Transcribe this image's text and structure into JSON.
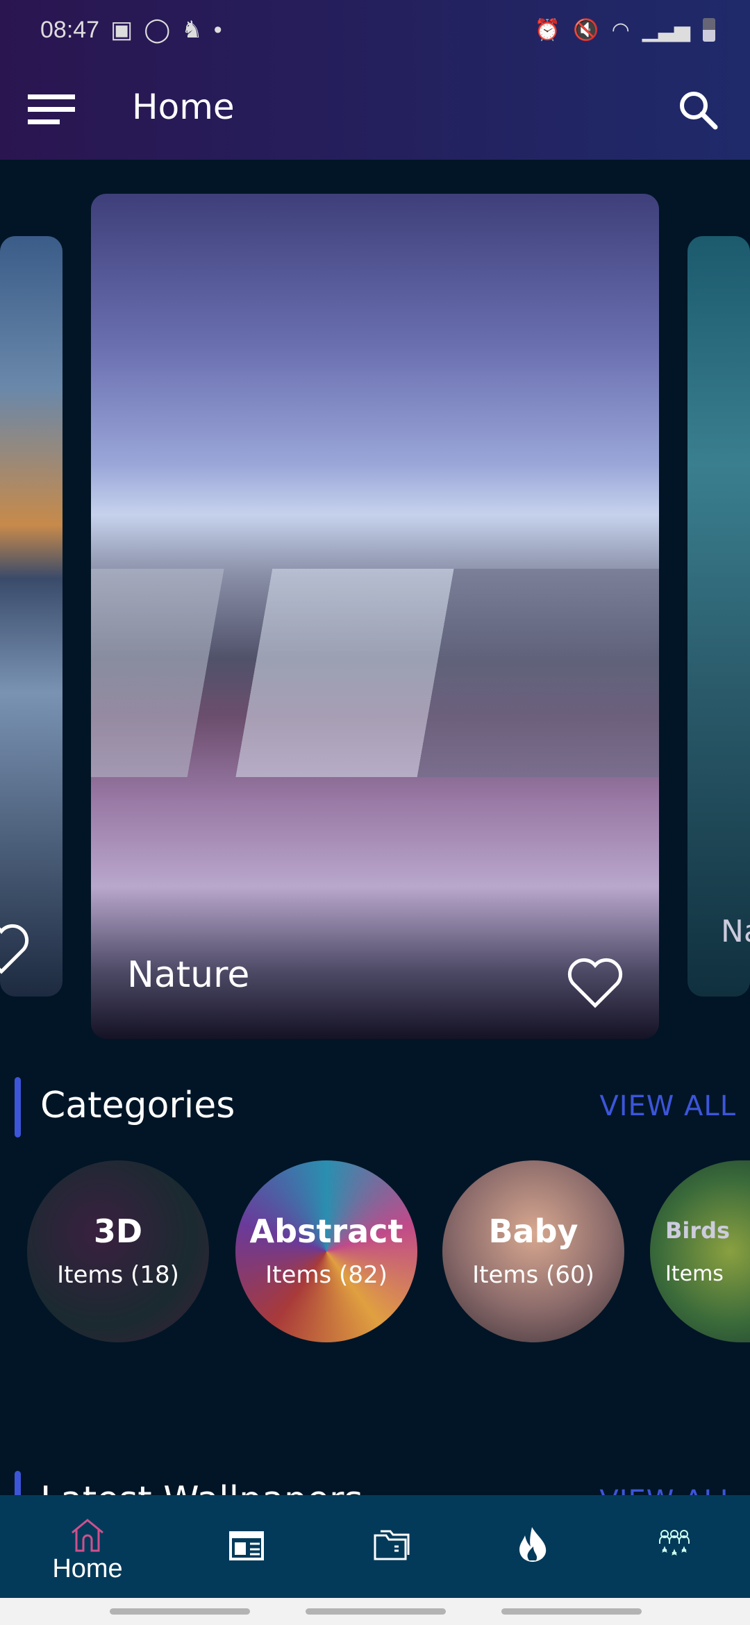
{
  "status_bar": {
    "time": "08:47"
  },
  "header": {
    "title": "Home"
  },
  "carousel": [
    {
      "title": "Nature"
    },
    {
      "title": "Nature"
    }
  ],
  "categories": {
    "title": "Categories",
    "view_all": "VIEW ALL",
    "items": [
      {
        "name": "3D",
        "count": "Items (18)"
      },
      {
        "name": "Abstract",
        "count": "Items (82)"
      },
      {
        "name": "Baby",
        "count": "Items (60)"
      },
      {
        "name": "Birds",
        "count": "Items"
      }
    ]
  },
  "latest": {
    "title": "Latest Wallpapers",
    "view_all": "VIEW ALL"
  },
  "bottom_nav": {
    "items": [
      {
        "label": "Home",
        "icon": "home-icon",
        "active": true
      },
      {
        "icon": "newspaper-icon"
      },
      {
        "icon": "folder-icon"
      },
      {
        "icon": "fire-icon"
      },
      {
        "icon": "group-icon"
      }
    ]
  },
  "colors": {
    "accent": "#3d55d9",
    "active_nav": "#d0508c",
    "nav_bg": "#033a5a",
    "bg": "#011526"
  }
}
